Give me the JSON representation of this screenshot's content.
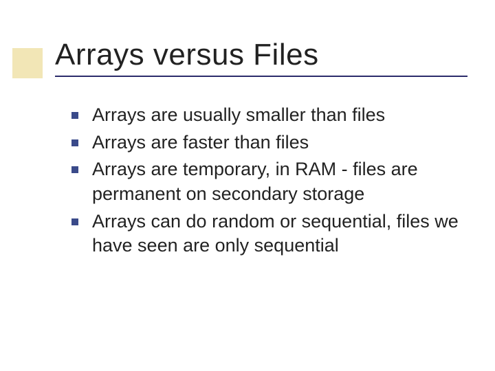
{
  "slide": {
    "title": "Arrays versus Files",
    "bullets": [
      "Arrays are usually smaller than files",
      "Arrays are faster than files",
      "Arrays are temporary, in RAM - files are permanent on secondary storage",
      "Arrays can do random or sequential, files we have seen are only sequential"
    ]
  }
}
